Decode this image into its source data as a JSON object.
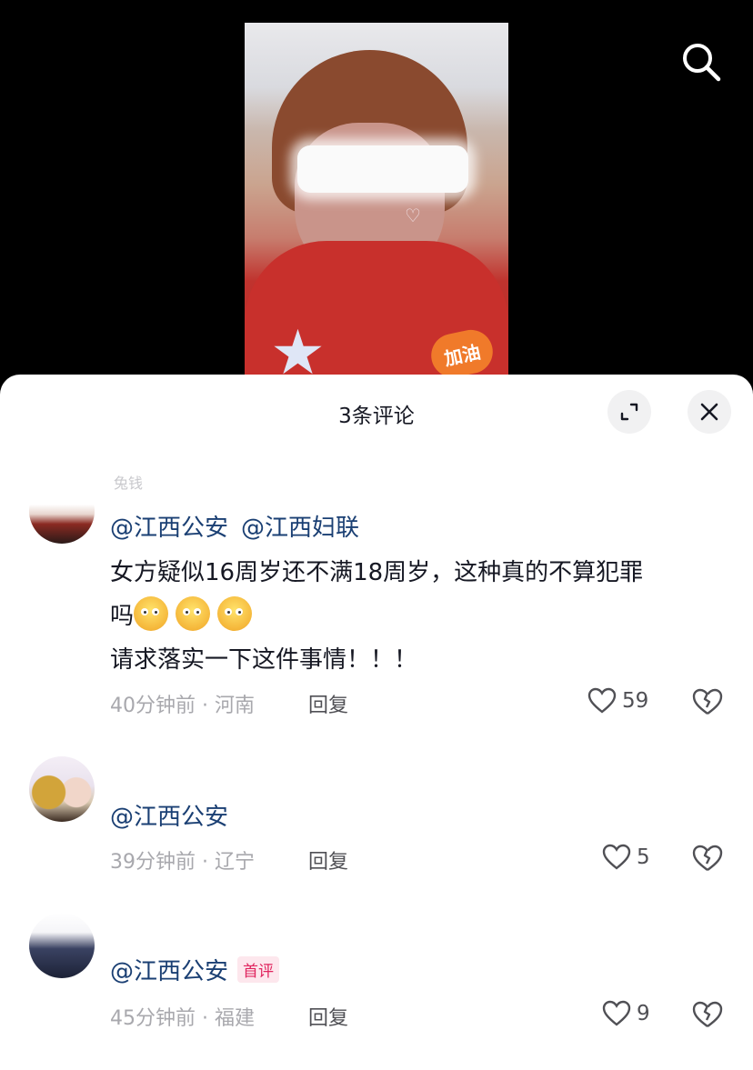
{
  "sheet": {
    "title": "3条评论"
  },
  "video": {
    "sticker_text": "加油"
  },
  "comments": [
    {
      "username": "兔钱",
      "mentions": [
        "@江西公安",
        "@江西妇联"
      ],
      "text_line1": "女方疑似16周岁还不满18周岁，这种真的不算犯罪",
      "text_line2_prefix": "吗",
      "text_line3": "请求落实一下这件事情！！！",
      "meta": "40分钟前 · 河南",
      "reply": "回复",
      "likes": "59"
    },
    {
      "mentions": [
        "@江西公安"
      ],
      "meta": "39分钟前 · 辽宁",
      "reply": "回复",
      "likes": "5"
    },
    {
      "mentions": [
        "@江西公安"
      ],
      "badge": "首评",
      "meta": "45分钟前 · 福建",
      "reply": "回复",
      "likes": "9"
    }
  ],
  "icons": {
    "search": "search-icon",
    "expand": "expand-icon",
    "close": "close-icon",
    "like": "heart-icon",
    "dislike": "broken-heart-icon"
  },
  "colors": {
    "mention": "#1a3f73",
    "badge": "#e0245e",
    "meta": "#a8a8ad"
  }
}
